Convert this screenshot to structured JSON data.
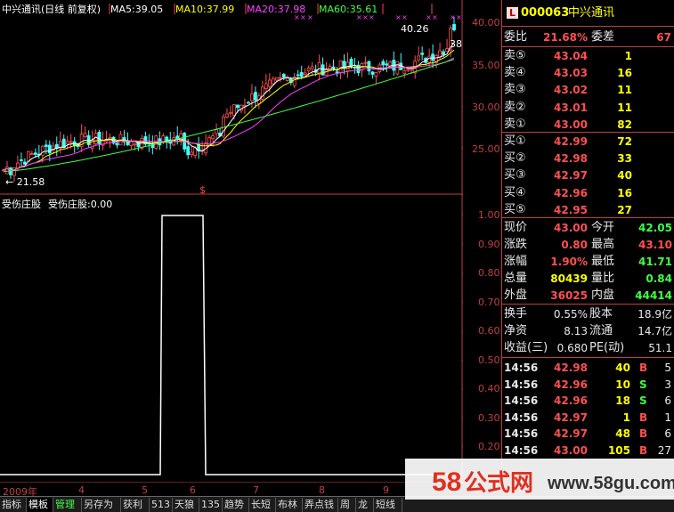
{
  "header": {
    "title": "中兴通讯(日线 前复权)",
    "ma5": "MA5:39.05",
    "ma10": "MA10:37.99",
    "ma20": "MA20:37.98",
    "ma60": "MA60:35.61",
    "high_label": "40.26",
    "low_label": "← 21.58",
    "side_label": "38",
    "dollar": "$"
  },
  "colors": {
    "ma5": "#ffffff",
    "ma10": "#ffff00",
    "ma20": "#ff40ff",
    "ma60": "#40ff40",
    "up": "#ff5050",
    "down": "#40ff40",
    "axis": "#c04040"
  },
  "price_axis": [
    "40.00",
    "35.00",
    "30.00",
    "25.00"
  ],
  "indicator": {
    "title": "受伤庄股",
    "value_text": "受伤庄股:0.00",
    "ticks": [
      "1.00",
      "0.90",
      "0.80",
      "0.70",
      "0.60",
      "0.50",
      "0.40",
      "0.30",
      "0.20",
      "0.10"
    ]
  },
  "months": [
    "2009年",
    "4",
    "5",
    "6",
    "7",
    "8",
    "9"
  ],
  "quote": {
    "badge": "L",
    "code": "000063",
    "name": "中兴通讯",
    "weibi_label": "委比",
    "weibi": "21.68%",
    "weicha_label": "委差",
    "weicha": "67",
    "sells": [
      {
        "label": "卖⑤",
        "price": "43.04",
        "vol": "1"
      },
      {
        "label": "卖④",
        "price": "43.03",
        "vol": "16"
      },
      {
        "label": "卖③",
        "price": "43.02",
        "vol": "11"
      },
      {
        "label": "卖②",
        "price": "43.01",
        "vol": "11"
      },
      {
        "label": "卖①",
        "price": "43.00",
        "vol": "82"
      }
    ],
    "buys": [
      {
        "label": "买①",
        "price": "42.99",
        "vol": "72"
      },
      {
        "label": "买②",
        "price": "42.98",
        "vol": "33"
      },
      {
        "label": "买③",
        "price": "42.97",
        "vol": "40"
      },
      {
        "label": "买④",
        "price": "42.96",
        "vol": "16"
      },
      {
        "label": "买⑤",
        "price": "42.95",
        "vol": "27"
      }
    ],
    "stats1": [
      {
        "l1": "现价",
        "v1": "43.00",
        "c1": "#ff5050",
        "l2": "今开",
        "v2": "42.05",
        "c2": "#40ff40"
      },
      {
        "l1": "涨跌",
        "v1": "0.80",
        "c1": "#ff5050",
        "l2": "最高",
        "v2": "43.10",
        "c2": "#ff5050"
      },
      {
        "l1": "涨幅",
        "v1": "1.90%",
        "c1": "#ff5050",
        "l2": "最低",
        "v2": "41.71",
        "c2": "#40ff40"
      },
      {
        "l1": "总量",
        "v1": "80439",
        "c1": "#ffff00",
        "l2": "量比",
        "v2": "0.84",
        "c2": "#40ff40"
      },
      {
        "l1": "外盘",
        "v1": "36025",
        "c1": "#ff5050",
        "l2": "内盘",
        "v2": "44414",
        "c2": "#40ff40"
      }
    ],
    "stats2": [
      {
        "l1": "换手",
        "v1": "0.55%",
        "l2": "股本",
        "v2": "18.9亿"
      },
      {
        "l1": "净资",
        "v1": "8.13",
        "l2": "流通",
        "v2": "14.7亿"
      },
      {
        "l1": "收益(三)",
        "v1": "0.680",
        "l2": "PE(动)",
        "v2": "51.1"
      }
    ],
    "ticks": [
      {
        "time": "14:56",
        "price": "42.98",
        "vol": "40",
        "bs": "B",
        "n": "5"
      },
      {
        "time": "14:56",
        "price": "42.96",
        "vol": "10",
        "bs": "S",
        "n": "3"
      },
      {
        "time": "14:56",
        "price": "42.96",
        "vol": "18",
        "bs": "S",
        "n": "6"
      },
      {
        "time": "14:56",
        "price": "42.97",
        "vol": "1",
        "bs": "B",
        "n": "1"
      },
      {
        "time": "14:56",
        "price": "42.97",
        "vol": "48",
        "bs": "B",
        "n": "6"
      },
      {
        "time": "14:56",
        "price": "43.00",
        "vol": "105",
        "bs": "B",
        "n": "27"
      }
    ]
  },
  "tabs": [
    "指标",
    "模板",
    "管理",
    "另存为",
    "获利",
    "513",
    "天狼",
    "135",
    "趋势",
    "长短",
    "布林",
    "弄点钱",
    "周",
    "龙",
    "短线"
  ],
  "watermark": {
    "brand_num": "58",
    "brand_cn": "公式网",
    "url": "www.58gu.com"
  }
}
